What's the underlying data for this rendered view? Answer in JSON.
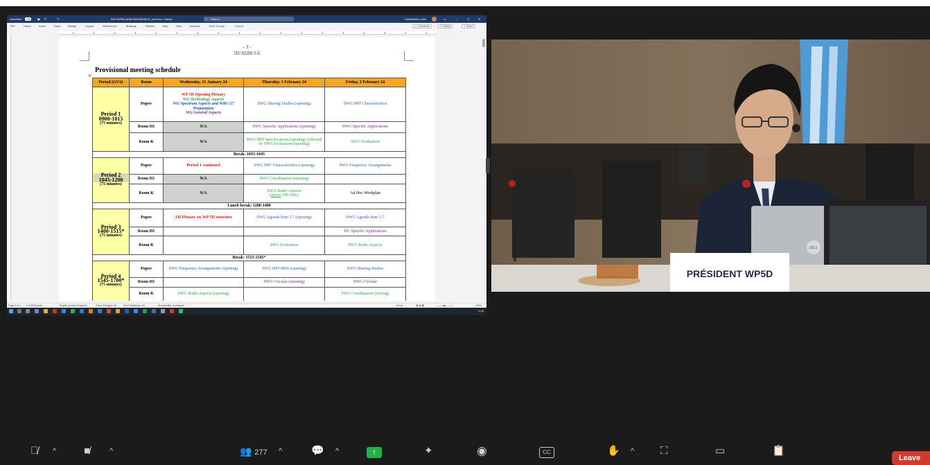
{
  "word": {
    "autosave_label": "AutoSave",
    "autosave_state": "Off",
    "filename": "R23-WP5D-ADM-0003!!MSW-E_wb.docx • Saved",
    "search_placeholder": "Search",
    "user_name": "Lamenstein, Uwe",
    "menu": [
      "File",
      "Home",
      "Insert",
      "Draw",
      "Design",
      "Layout",
      "References",
      "Mailings",
      "Review",
      "View",
      "Help",
      "Acrobat",
      "Table Design",
      "Layout"
    ],
    "comments_label": "Comments",
    "editing_label": "Editing",
    "share_label": "Share",
    "status": {
      "page": "Page 3 of 4",
      "words": "3 of 825 words",
      "language": "English (United Kingdom)",
      "track_changes": "Track Changes: Off",
      "text_predictions": "Text Predictions: On",
      "accessibility": "Accessibility: Investigate",
      "focus": "Focus",
      "zoom": "100%"
    },
    "clock": "11:46"
  },
  "doc": {
    "page_number": "- 3 -",
    "doc_ref": "5D/ADM/3-E",
    "title": "Provisional meeting schedule",
    "headers": [
      "Period (GVA)",
      "Room",
      "Wednesday, 31 January 24",
      "Thursday, 1 February 24",
      "Friday, 2 February 24"
    ],
    "p1": {
      "name": "Period 1",
      "time": "0900-1015",
      "dur": "(75 minutes)",
      "popov_label": "Popov",
      "wed_popov": [
        "WP 5D Opening Plenary",
        "WG Technology Aspects",
        "WG Spectrum Aspects and WRC-27 Preparation",
        "WG General Aspects"
      ],
      "thu_popov": "SWG Sharing Studies (opening)",
      "fri_popov": "SWG IMT Characteristics",
      "h1_label": "Room H1",
      "wed_h1": "N/A",
      "thu_h1": "SWG Specific Applications (opening)",
      "fri_h1": "SWG Specific Applications",
      "k_label": "Room K",
      "wed_k": "N/A",
      "thu_k": "SWG IMT Specifications (opening) followed by SWG Evaluation (opening)",
      "fri_k": "SWG Evaluation"
    },
    "break1": "Break: 1015-1045",
    "p2": {
      "name": "Period 2",
      "time": "1045-1200",
      "dur": "(75 minutes)",
      "popov_label": "Popov",
      "wed_popov": "Period 1 continued",
      "thu_popov": "SWG IMT Characteristics (opening)",
      "fri_popov": "SWG Frequency Arrangements",
      "h1_label": "Room H1",
      "wed_h1": "N/A",
      "thu_h1": "SWG Coordination (opening)",
      "fri_h1": "",
      "k_label": "Room K",
      "wed_k": "N/A",
      "thu_k_1": "SWG Radio Aspects",
      "thu_k_2a": "(",
      "thu_k_2b": "above",
      "thu_k_2c": " 100 GHz)",
      "fri_k": "Ad Hoc Workplan"
    },
    "lunch": "Lunch break: 1200-1400",
    "p3": {
      "name": "Period 3",
      "time": "1400-1515*",
      "dur": "(75 minutes)",
      "popov_label": "Popov",
      "wed_popov": "AH Plenary on WP 5D structure",
      "thu_popov": "SWG Agenda Item 1.7 (opening)",
      "fri_popov": "SWG Agenda Item 1.7",
      "h1_label": "Room H1",
      "wed_h1": "",
      "thu_h1": "",
      "fri_h1": "DG Specific Applications",
      "k_label": "Room K",
      "wed_k": "",
      "thu_k": "SWG Evaluation",
      "fri_k": "SWG Radio Aspects"
    },
    "break2": "Break: 1515-1545*",
    "p4": {
      "name": "Period 4",
      "time": "1545-1700*",
      "dur": "(75 minutes)",
      "popov_label": "Popov",
      "wed_popov": "SWG Frequency Arrangements (opening)",
      "thu_popov": "SWG IMT-MSS (opening)",
      "fri_popov": "SWG Sharing Studies",
      "h1_label": "Room H1",
      "wed_h1": "",
      "thu_h1": "SWG Circular (opening)",
      "fri_h1": "SWG Circular",
      "k_label": "Room K",
      "wed_k": "SWG Radio Aspects (opening)",
      "thu_k": "",
      "fri_k": "SWG Coordination (closing)"
    }
  },
  "video": {
    "nameplate": "PRÉSIDENT WP5D",
    "laptop_brand": "DELL"
  },
  "zoom_bar": {
    "participants_count": "277",
    "cc_label": "CC",
    "leave_label": "Leave"
  }
}
